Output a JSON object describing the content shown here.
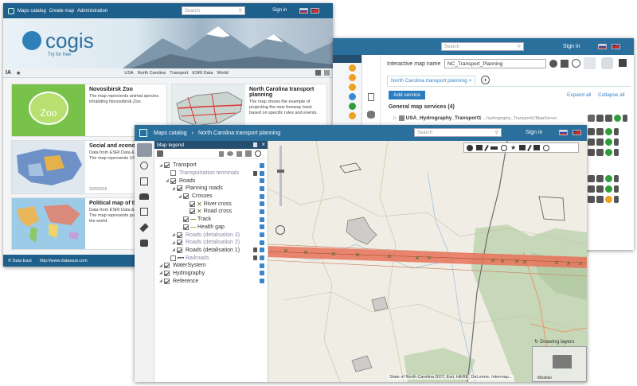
{
  "back": {
    "nav": [
      "Maps catalog",
      "Create map",
      "Administration"
    ],
    "search_placeholder": "Search",
    "signin": "Sign in",
    "brand": "cogis",
    "tagline": "Try for free",
    "filter_icons": "IA",
    "filters": [
      "USA",
      "North Carolina",
      "Transport",
      "ESRI Data",
      "World"
    ],
    "cards": [
      {
        "title": "Novosibirsk Zoo",
        "desc": "The map represents animal species inhabiting Novosibirsk Zoo.",
        "thumb_text": "Zoo"
      },
      {
        "title": "North Carolina transport planning",
        "desc": "The map shows the example of projecting the new freeway track based on specific rules and events."
      },
      {
        "title": "Social and economic",
        "desc": "Data from ESRI Data & M... The map represents USA",
        "date": "2/25/2015"
      },
      {
        "title": "Political map of the",
        "desc": "Data from ESRI Data & M... The map represents politi... the world."
      }
    ],
    "footer": [
      "© Data East",
      "http://www.dataeast.com"
    ]
  },
  "mid": {
    "search_placeholder": "Search",
    "signin": "Sign in",
    "map_name_label": "Interactive map name",
    "map_name_value": "NC_Transport_Planning",
    "tab": "North Carolina transport planning",
    "add_service": "Add service",
    "expand_all": "Expand all",
    "collapse_all": "Collapse all",
    "section": "General map services (4)",
    "service_name": "USA_Hydrography_Transport1",
    "service_url": "...hydrography_Transport1/MapServer"
  },
  "front": {
    "nav": [
      "Maps catalog",
      "North Carolina transport planning"
    ],
    "search_placeholder": "Search",
    "signin": "Sign in",
    "legend_title": "Map legend",
    "tree": [
      {
        "label": "Transport",
        "level": 0,
        "dim": false,
        "checked": true
      },
      {
        "label": "Transportation terminals",
        "level": 1,
        "dim": true,
        "checked": false
      },
      {
        "label": "Roads",
        "level": 1,
        "dim": false,
        "checked": true
      },
      {
        "label": "Planning roads",
        "level": 2,
        "dim": false,
        "checked": true
      },
      {
        "label": "Crosses",
        "level": 3,
        "dim": false,
        "checked": true
      },
      {
        "label": "River cross",
        "level": 4,
        "dim": false,
        "checked": true
      },
      {
        "label": "Road cross",
        "level": 4,
        "dim": false,
        "checked": true
      },
      {
        "label": "Track",
        "level": 3,
        "dim": false,
        "checked": true
      },
      {
        "label": "Health gap",
        "level": 3,
        "dim": false,
        "checked": true
      },
      {
        "label": "Roads (detalisation 3)",
        "level": 2,
        "dim": true,
        "checked": true
      },
      {
        "label": "Roads (detalisation 2)",
        "level": 2,
        "dim": true,
        "checked": true
      },
      {
        "label": "Roads (detalisation 1)",
        "level": 2,
        "dim": false,
        "checked": true
      },
      {
        "label": "Railroads",
        "level": 1,
        "dim": true,
        "checked": false
      },
      {
        "label": "WaterSystem",
        "level": 0,
        "dim": false,
        "checked": true
      },
      {
        "label": "Hydrography",
        "level": 0,
        "dim": false,
        "checked": true
      },
      {
        "label": "Reference",
        "level": 0,
        "dim": false,
        "checked": true
      }
    ],
    "drawing_layers": "Drawing layers",
    "attribution": "State of North Carolina DOT, Esri, HERE, DeLorme, Intermap...",
    "minimap_label": "Missilan"
  }
}
